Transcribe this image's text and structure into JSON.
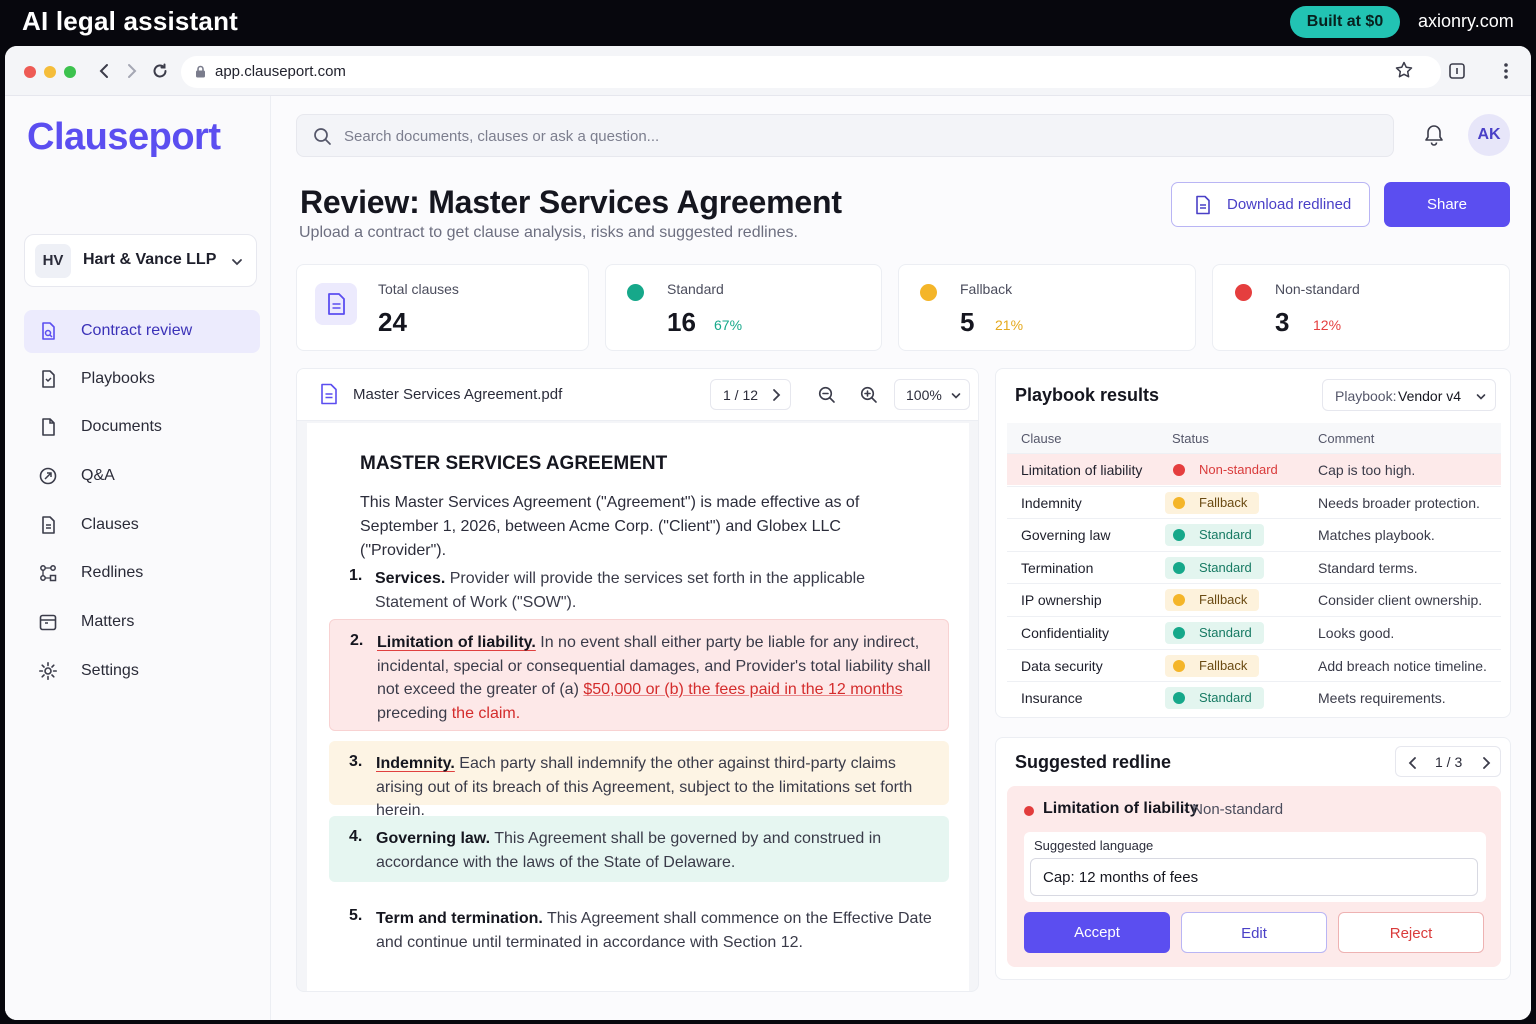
{
  "banner": {
    "title": "AI legal assistant",
    "badge": "Built at $0",
    "site": "axionry.com"
  },
  "browser": {
    "url": "app.clauseport.com"
  },
  "sidebar": {
    "brand": "Clauseport",
    "org": {
      "initials": "HV",
      "name": "Hart & Vance LLP"
    },
    "items": [
      {
        "label": "Contract review",
        "icon": "document-review-icon",
        "active": true
      },
      {
        "label": "Playbooks",
        "icon": "playbook-icon"
      },
      {
        "label": "Documents",
        "icon": "document-icon"
      },
      {
        "label": "Q&A",
        "icon": "chat-icon"
      },
      {
        "label": "Clauses",
        "icon": "clause-icon"
      },
      {
        "label": "Redlines",
        "icon": "redline-icon"
      },
      {
        "label": "Matters",
        "icon": "calendar-icon"
      },
      {
        "label": "Settings",
        "icon": "gear-icon"
      }
    ]
  },
  "header": {
    "search_placeholder": "Search documents, clauses or ask a question...",
    "avatar": "AK",
    "title": "Review: Master Services Agreement",
    "subtitle": "Upload a contract to get clause analysis, risks and suggested redlines.",
    "download_label": "Download redlined",
    "share_label": "Share"
  },
  "stats": {
    "total": {
      "label": "Total clauses",
      "value": "24"
    },
    "standard": {
      "label": "Standard",
      "value": "16",
      "pct": "67%",
      "color": "#16a88a"
    },
    "fallback": {
      "label": "Fallback",
      "value": "5",
      "pct": "21%",
      "color": "#f4b529"
    },
    "nonstandard": {
      "label": "Non-standard",
      "value": "3",
      "pct": "12%",
      "color": "#e53e3e"
    }
  },
  "viewer": {
    "file": "Master Services Agreement.pdf",
    "page": "1 / 12",
    "zoom": "100%",
    "heading": "MASTER SERVICES AGREEMENT",
    "intro": "This Master Services Agreement (\"Agreement\") is made effective as of September 1, 2026, between Acme Corp. (\"Client\") and Globex LLC (\"Provider\").",
    "clauses": [
      {
        "num": "1.",
        "title": "Services.",
        "text": "Provider will provide the services set forth in the applicable Statement of Work (\"SOW\")."
      },
      {
        "num": "2.",
        "title": "Limitation of liability.",
        "text": "In no event shall either party be liable for any indirect, incidental, special or consequential damages, and Provider's total liability shall not exceed the greater of (a) ",
        "highlight": "$50,000 or (b) the fees paid in the 12 months",
        "text2": " preceding ",
        "highlight2": "the claim."
      },
      {
        "num": "3.",
        "title": "Indemnity.",
        "text": "Each party shall indemnify the other against third-party claims arising out of its breach of this Agreement, subject to the limitations set forth herein."
      },
      {
        "num": "4.",
        "title": "Governing law.",
        "text": "This Agreement shall be governed by and construed in accordance with the laws of the State of Delaware."
      },
      {
        "num": "5.",
        "title": "Term and termination.",
        "text": "This Agreement shall commence on the Effective Date and continue until terminated in accordance with Section 12."
      }
    ]
  },
  "playbook": {
    "title": "Playbook results",
    "select_label": "Playbook:",
    "select_value": "Vendor v4",
    "columns": [
      "Clause",
      "Status",
      "Comment"
    ],
    "rows": [
      {
        "clause": "Limitation of liability",
        "status": "Non-standard",
        "comment": "Cap is too high."
      },
      {
        "clause": "Indemnity",
        "status": "Fallback",
        "comment": "Needs broader protection."
      },
      {
        "clause": "Governing law",
        "status": "Standard",
        "comment": "Matches playbook."
      },
      {
        "clause": "Termination",
        "status": "Standard",
        "comment": "Standard terms."
      },
      {
        "clause": "IP ownership",
        "status": "Fallback",
        "comment": "Consider client ownership."
      },
      {
        "clause": "Confidentiality",
        "status": "Standard",
        "comment": "Looks good."
      },
      {
        "clause": "Data security",
        "status": "Fallback",
        "comment": "Add breach notice timeline."
      },
      {
        "clause": "Insurance",
        "status": "Standard",
        "comment": "Meets requirements."
      }
    ]
  },
  "redline": {
    "title": "Suggested redline",
    "pager": "1 / 3",
    "clause": "Limitation of liability",
    "status": "· Non-standard",
    "field_label": "Suggested language",
    "field_value": "Cap: 12 months of fees",
    "accept": "Accept",
    "edit": "Edit",
    "reject": "Reject"
  }
}
